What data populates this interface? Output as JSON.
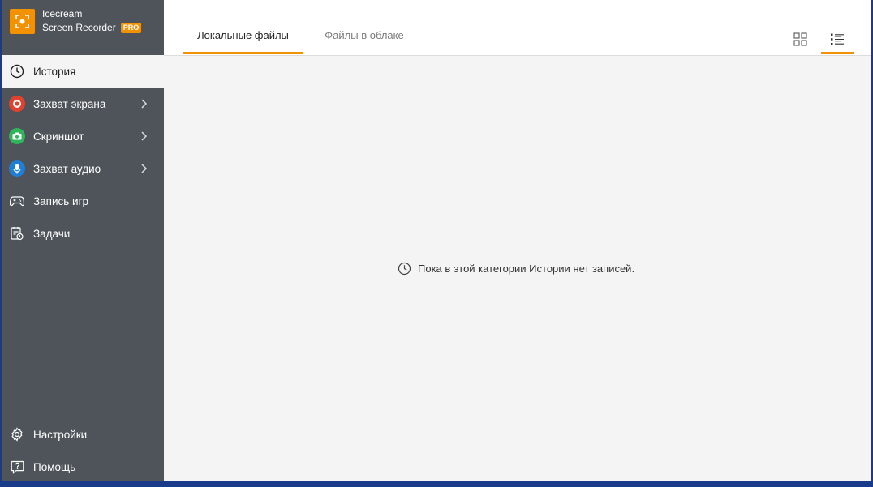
{
  "app": {
    "name_line1": "Icecream",
    "name_line2": "Screen Recorder",
    "pro_badge": "PRO",
    "accent_color": "#f39200"
  },
  "sidebar": {
    "items": [
      {
        "label": "История",
        "icon": "clock-icon",
        "active": true
      },
      {
        "label": "Захват экрана",
        "icon": "record-icon",
        "has_submenu": true
      },
      {
        "label": "Скриншот",
        "icon": "camera-icon",
        "has_submenu": true
      },
      {
        "label": "Захват аудио",
        "icon": "microphone-icon",
        "has_submenu": true
      },
      {
        "label": "Запись игр",
        "icon": "gamepad-icon"
      },
      {
        "label": "Задачи",
        "icon": "tasks-icon"
      }
    ],
    "bottom_items": [
      {
        "label": "Настройки",
        "icon": "gear-icon"
      },
      {
        "label": "Помощь",
        "icon": "help-icon"
      }
    ]
  },
  "tabs": [
    {
      "label": "Локальные файлы",
      "active": true
    },
    {
      "label": "Файлы в облаке",
      "active": false
    }
  ],
  "view_modes": {
    "grid": "grid-view-icon",
    "list": "list-view-icon",
    "active": "list"
  },
  "empty_state": {
    "message": "Пока в этой категории Истории нет записей."
  }
}
